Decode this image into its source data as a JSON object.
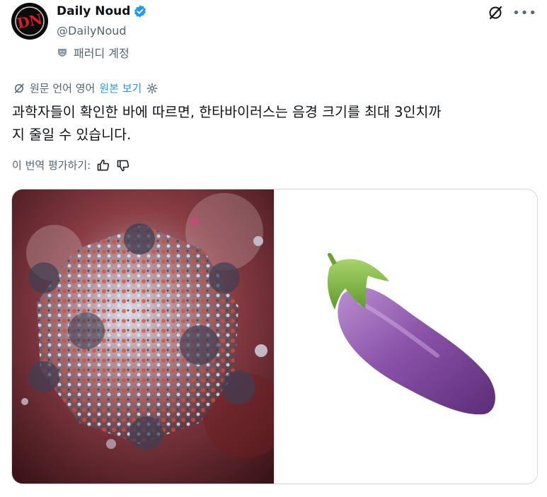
{
  "author": {
    "display_name": "Daily Noud",
    "handle": "@DailyNoud",
    "avatar_text": "DN",
    "parody_label": "패러디 계정"
  },
  "translation": {
    "source_label": "원문 언어 영어",
    "show_original": "원본 보기"
  },
  "tweet": {
    "text": "과학자들이 확인한 바에 따르면, 한타바이러스는 음경 크기를 최대 3인치까\n지 줄일 수 있습니다."
  },
  "rating": {
    "label": "이 번역 평가하기:"
  },
  "media": {
    "left_image": "virus-illustration",
    "right_image": "eggplant-emoji"
  },
  "colors": {
    "accent": "#1d9bf0",
    "muted": "#536471",
    "text": "#0f1419"
  }
}
